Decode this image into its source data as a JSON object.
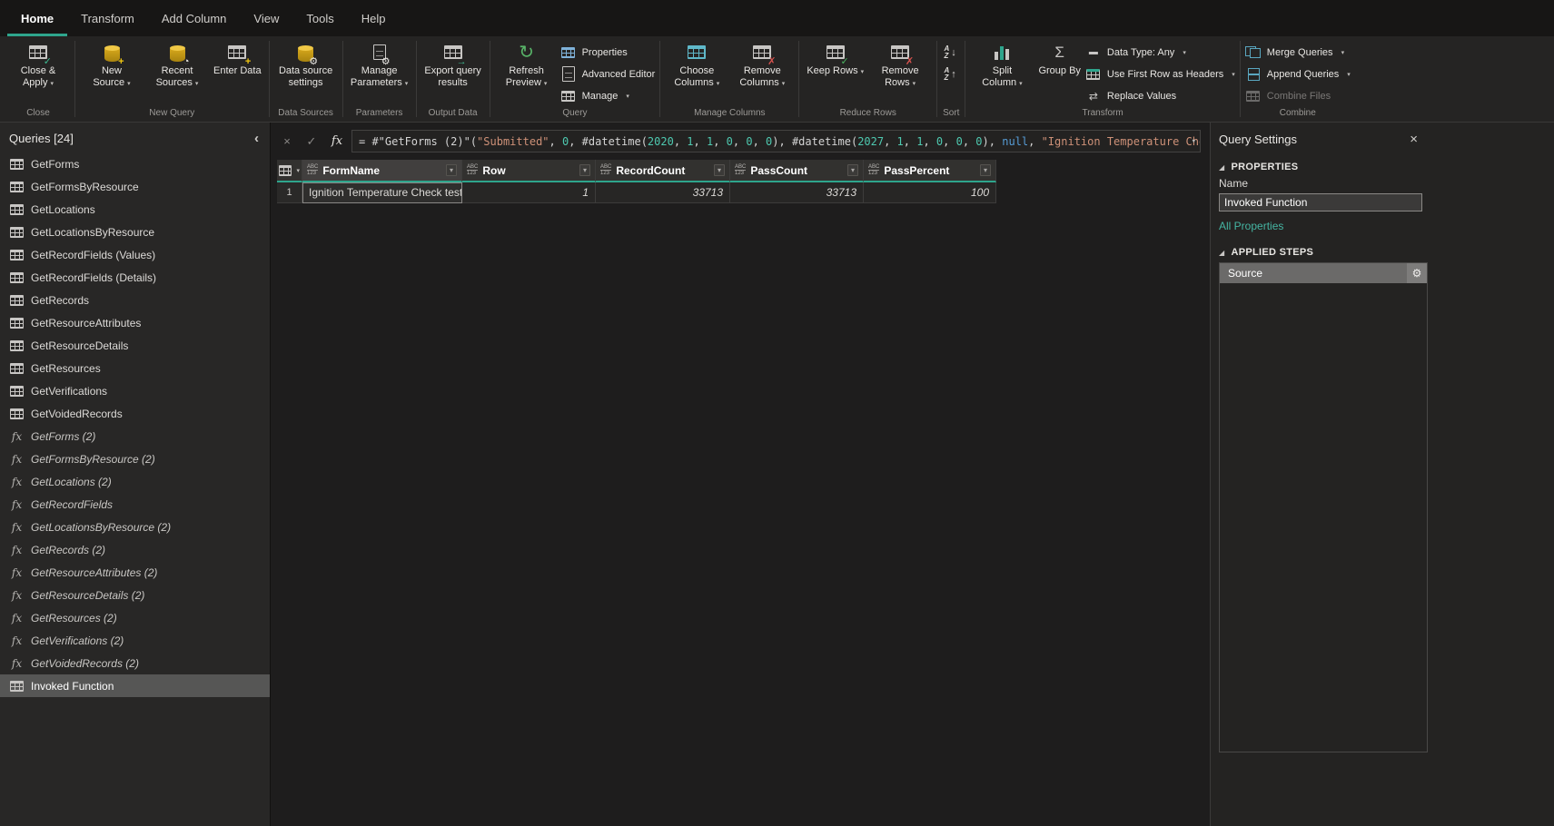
{
  "accent": "#2ea58c",
  "menubar": {
    "active": "Home",
    "items": [
      "Home",
      "Transform",
      "Add Column",
      "View",
      "Tools",
      "Help"
    ]
  },
  "ribbon": {
    "groups": [
      {
        "caption": "Close",
        "items": [
          {
            "kind": "large",
            "label": "Close & Apply",
            "icon": "close-apply",
            "dropdown": true
          }
        ]
      },
      {
        "caption": "New Query",
        "items": [
          {
            "kind": "large",
            "label": "New Source",
            "icon": "new-source",
            "dropdown": true
          },
          {
            "kind": "large",
            "label": "Recent Sources",
            "icon": "recent-sources",
            "dropdown": true
          },
          {
            "kind": "large",
            "label": "Enter Data",
            "icon": "enter-data"
          }
        ]
      },
      {
        "caption": "Data Sources",
        "items": [
          {
            "kind": "large",
            "label": "Data source settings",
            "icon": "data-source-settings"
          }
        ]
      },
      {
        "caption": "Parameters",
        "items": [
          {
            "kind": "large",
            "label": "Manage Parameters",
            "icon": "manage-parameters",
            "dropdown": true
          }
        ]
      },
      {
        "caption": "Output Data",
        "items": [
          {
            "kind": "large",
            "label": "Export query results",
            "icon": "export-query-results"
          }
        ]
      },
      {
        "caption": "Query",
        "items": [
          {
            "kind": "large",
            "label": "Refresh Preview",
            "icon": "refresh-preview",
            "dropdown": true
          },
          {
            "kind": "stack",
            "buttons": [
              {
                "label": "Properties",
                "icon": "properties"
              },
              {
                "label": "Advanced Editor",
                "icon": "advanced-editor"
              },
              {
                "label": "Manage",
                "icon": "manage",
                "dropdown": true
              }
            ]
          }
        ]
      },
      {
        "caption": "Manage Columns",
        "items": [
          {
            "kind": "large",
            "label": "Choose Columns",
            "icon": "choose-columns",
            "dropdown": true
          },
          {
            "kind": "large",
            "label": "Remove Columns",
            "icon": "remove-columns",
            "dropdown": true
          }
        ]
      },
      {
        "caption": "Reduce Rows",
        "items": [
          {
            "kind": "large",
            "label": "Keep Rows",
            "icon": "keep-rows",
            "dropdown": true
          },
          {
            "kind": "large",
            "label": "Remove Rows",
            "icon": "remove-rows",
            "dropdown": true
          }
        ]
      },
      {
        "caption": "Sort",
        "items": [
          {
            "kind": "stack",
            "buttons": [
              {
                "label": "",
                "icon": "sort-ascending"
              },
              {
                "label": "",
                "icon": "sort-descending"
              }
            ]
          }
        ]
      },
      {
        "caption": "Transform",
        "items": [
          {
            "kind": "large",
            "label": "Split Column",
            "icon": "split-column",
            "dropdown": true
          },
          {
            "kind": "large",
            "label": "Group By",
            "icon": "group-by"
          },
          {
            "kind": "stack",
            "buttons": [
              {
                "label": "Data Type: Any",
                "icon": "data-type",
                "dropdown": true
              },
              {
                "label": "Use First Row as Headers",
                "icon": "use-first-row",
                "dropdown": true
              },
              {
                "label": "Replace Values",
                "icon": "replace-values"
              }
            ]
          }
        ]
      },
      {
        "caption": "Combine",
        "items": [
          {
            "kind": "stack",
            "buttons": [
              {
                "label": "Merge Queries",
                "icon": "merge-queries",
                "dropdown": true
              },
              {
                "label": "Append Queries",
                "icon": "append-queries",
                "dropdown": true
              },
              {
                "label": "Combine Files",
                "icon": "combine-files",
                "disabled": true
              }
            ]
          }
        ]
      }
    ]
  },
  "sidebar": {
    "title": "Queries [24]",
    "collapse_icon": "‹",
    "items": [
      {
        "label": "GetForms",
        "type": "table"
      },
      {
        "label": "GetFormsByResource",
        "type": "table"
      },
      {
        "label": "GetLocations",
        "type": "table"
      },
      {
        "label": "GetLocationsByResource",
        "type": "table"
      },
      {
        "label": "GetRecordFields (Values)",
        "type": "table"
      },
      {
        "label": "GetRecordFields (Details)",
        "type": "table"
      },
      {
        "label": "GetRecords",
        "type": "table"
      },
      {
        "label": "GetResourceAttributes",
        "type": "table"
      },
      {
        "label": "GetResourceDetails",
        "type": "table"
      },
      {
        "label": "GetResources",
        "type": "table"
      },
      {
        "label": "GetVerifications",
        "type": "table"
      },
      {
        "label": "GetVoidedRecords",
        "type": "table"
      },
      {
        "label": "GetForms (2)",
        "type": "function"
      },
      {
        "label": "GetFormsByResource (2)",
        "type": "function"
      },
      {
        "label": "GetLocations (2)",
        "type": "function"
      },
      {
        "label": "GetRecordFields",
        "type": "function"
      },
      {
        "label": "GetLocationsByResource (2)",
        "type": "function"
      },
      {
        "label": "GetRecords (2)",
        "type": "function"
      },
      {
        "label": "GetResourceAttributes (2)",
        "type": "function"
      },
      {
        "label": "GetResourceDetails (2)",
        "type": "function"
      },
      {
        "label": "GetResources (2)",
        "type": "function"
      },
      {
        "label": "GetVerifications (2)",
        "type": "function"
      },
      {
        "label": "GetVoidedRecords (2)",
        "type": "function"
      },
      {
        "label": "Invoked Function",
        "type": "table",
        "selected": true
      }
    ]
  },
  "formula_bar": {
    "fx_label": "fx",
    "cancel_label": "×",
    "check_label": "✓",
    "segments": [
      {
        "type": "plain",
        "text": "= #\"GetForms (2)\"("
      },
      {
        "type": "string",
        "text": "\"Submitted\""
      },
      {
        "type": "plain",
        "text": ", "
      },
      {
        "type": "number",
        "text": "0"
      },
      {
        "type": "plain",
        "text": ", #datetime("
      },
      {
        "type": "number",
        "text": "2020"
      },
      {
        "type": "plain",
        "text": ", "
      },
      {
        "type": "number",
        "text": "1"
      },
      {
        "type": "plain",
        "text": ", "
      },
      {
        "type": "number",
        "text": "1"
      },
      {
        "type": "plain",
        "text": ", "
      },
      {
        "type": "number",
        "text": "0"
      },
      {
        "type": "plain",
        "text": ", "
      },
      {
        "type": "number",
        "text": "0"
      },
      {
        "type": "plain",
        "text": ", "
      },
      {
        "type": "number",
        "text": "0"
      },
      {
        "type": "plain",
        "text": "), #datetime("
      },
      {
        "type": "number",
        "text": "2027"
      },
      {
        "type": "plain",
        "text": ", "
      },
      {
        "type": "number",
        "text": "1"
      },
      {
        "type": "plain",
        "text": ", "
      },
      {
        "type": "number",
        "text": "1"
      },
      {
        "type": "plain",
        "text": ", "
      },
      {
        "type": "number",
        "text": "0"
      },
      {
        "type": "plain",
        "text": ", "
      },
      {
        "type": "number",
        "text": "0"
      },
      {
        "type": "plain",
        "text": ", "
      },
      {
        "type": "number",
        "text": "0"
      },
      {
        "type": "plain",
        "text": "), "
      },
      {
        "type": "keyword",
        "text": "null"
      },
      {
        "type": "plain",
        "text": ", "
      },
      {
        "type": "string",
        "text": "\"Ignition Temperature Check test\""
      },
      {
        "type": "plain",
        "text": ", "
      },
      {
        "type": "keyword",
        "text": "null"
      },
      {
        "type": "plain",
        "text": ","
      }
    ]
  },
  "grid": {
    "columns": [
      {
        "name": "FormName",
        "datatype_icon": "ABC/123",
        "align": "left",
        "selected": true
      },
      {
        "name": "Row",
        "datatype_icon": "ABC/123",
        "align": "right"
      },
      {
        "name": "RecordCount",
        "datatype_icon": "ABC/123",
        "align": "right"
      },
      {
        "name": "PassCount",
        "datatype_icon": "ABC/123",
        "align": "right"
      },
      {
        "name": "PassPercent",
        "datatype_icon": "ABC/123",
        "align": "right"
      }
    ],
    "rows": [
      {
        "num": "1",
        "cells": [
          "Ignition Temperature Check test",
          "1",
          "33713",
          "33713",
          "100"
        ]
      }
    ]
  },
  "settings": {
    "title": "Query Settings",
    "close_icon": "×",
    "properties_label": "PROPERTIES",
    "name_label": "Name",
    "name_value": "Invoked Function",
    "all_properties_label": "All Properties",
    "applied_steps_label": "APPLIED STEPS",
    "applied_steps": [
      {
        "label": "Source",
        "selected": true,
        "has_settings_gear": true
      }
    ]
  }
}
